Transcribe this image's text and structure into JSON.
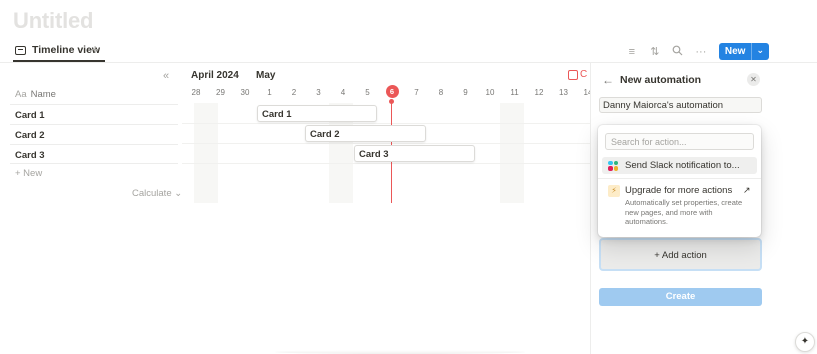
{
  "page": {
    "title": "Untitled"
  },
  "view": {
    "tab_label": "Timeline view",
    "add_icon": "plus-icon",
    "tab_icon": "timeline-view-icon"
  },
  "toolbar": {
    "filter_icon": "filter-icon",
    "sort_icon": "sort-icon",
    "search_icon": "search-icon",
    "more_icon": "more-icon",
    "new_label": "New",
    "accent": "#2383e2"
  },
  "table": {
    "name_prefix": "Aa",
    "name_header": "Name",
    "rows": [
      "Card 1",
      "Card 2",
      "Card 3"
    ],
    "new_label": "+ New",
    "calculate_label": "Calculate ⌄"
  },
  "timeline": {
    "months": [
      "April 2024",
      "May"
    ],
    "days": [
      "28",
      "29",
      "30",
      "1",
      "2",
      "3",
      "4",
      "5",
      "6",
      "7",
      "8",
      "9",
      "10",
      "11",
      "12",
      "13",
      "14"
    ],
    "today": "6",
    "today_color": "#eb5757",
    "cards": [
      {
        "label": "Card 1",
        "start_day": "1",
        "end_day": "5"
      },
      {
        "label": "Card 2",
        "start_day": "3",
        "end_day": "7"
      },
      {
        "label": "Card 3",
        "start_day": "5",
        "end_day": "9"
      }
    ],
    "calendar_label": "C"
  },
  "panel": {
    "title": "New automation",
    "automation_name": "Danny Maiorca's automation",
    "add_action_label": "+ Add action",
    "create_label": "Create"
  },
  "dropdown": {
    "search_placeholder": "Search for action...",
    "item_slack": "Send Slack notification to...",
    "upgrade_title": "Upgrade for more actions",
    "upgrade_desc": "Automatically set properties, create new pages, and more with automations.",
    "upgrade_arrow": "↗"
  },
  "help": {
    "icon": "sparkle-icon"
  }
}
